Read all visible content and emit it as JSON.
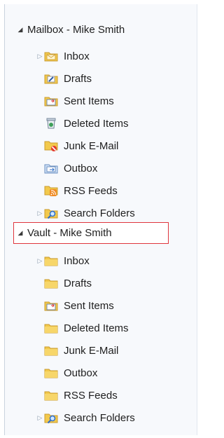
{
  "mailbox": {
    "label": "Mailbox - Mike Smith",
    "items": [
      {
        "label": "Inbox",
        "icon": "inbox-icon",
        "expandable": true
      },
      {
        "label": "Drafts",
        "icon": "drafts-icon",
        "expandable": false
      },
      {
        "label": "Sent Items",
        "icon": "sent-items-icon",
        "expandable": false
      },
      {
        "label": "Deleted Items",
        "icon": "deleted-items-icon",
        "expandable": false
      },
      {
        "label": "Junk E-Mail",
        "icon": "junk-email-icon",
        "expandable": false
      },
      {
        "label": "Outbox",
        "icon": "outbox-icon",
        "expandable": false
      },
      {
        "label": "RSS Feeds",
        "icon": "rss-feeds-icon",
        "expandable": false
      },
      {
        "label": "Search Folders",
        "icon": "search-folders-icon",
        "expandable": true
      }
    ]
  },
  "vault": {
    "label": "Vault - Mike Smith",
    "items": [
      {
        "label": "Inbox",
        "icon": "folder-icon",
        "expandable": true
      },
      {
        "label": "Drafts",
        "icon": "folder-icon",
        "expandable": false
      },
      {
        "label": "Sent Items",
        "icon": "sent-items-icon",
        "expandable": false
      },
      {
        "label": "Deleted Items",
        "icon": "folder-icon",
        "expandable": false
      },
      {
        "label": "Junk E-Mail",
        "icon": "folder-icon",
        "expandable": false
      },
      {
        "label": "Outbox",
        "icon": "folder-icon",
        "expandable": false
      },
      {
        "label": "RSS Feeds",
        "icon": "folder-icon",
        "expandable": false
      },
      {
        "label": "Search Folders",
        "icon": "search-folders-icon",
        "expandable": true
      }
    ]
  },
  "colors": {
    "selection_border": "#e0353d",
    "folder_yellow": "#f2c94c",
    "pane_bg": "#f7f9fc"
  }
}
